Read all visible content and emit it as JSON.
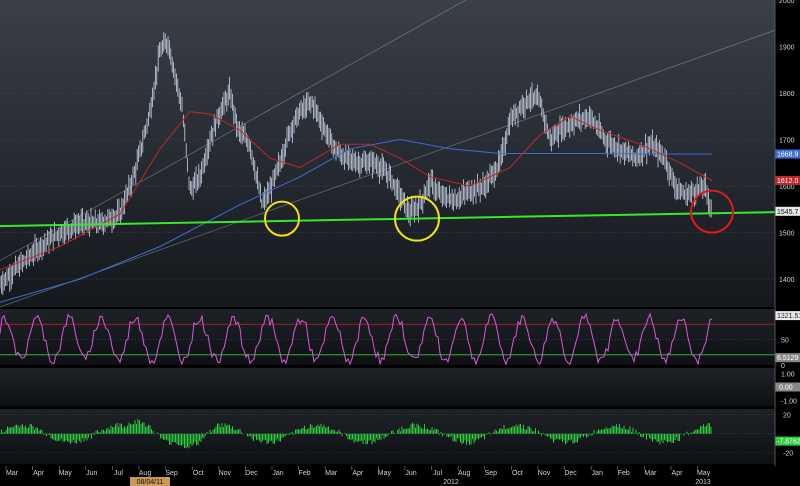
{
  "chart_data": [
    {
      "type": "line",
      "panel": "price",
      "chart_type": "ohlc",
      "ylim": [
        1340,
        2000
      ],
      "y_ticks": [
        "2000",
        "1900",
        "1800",
        "1700",
        "1600",
        "1500",
        "1400"
      ],
      "value_tags": [
        {
          "label": "1668.9",
          "value": 1668.9,
          "color": "#3a6fd0"
        },
        {
          "label": "1612.0",
          "value": 1612.0,
          "color": "#c0282a"
        },
        {
          "label": "1545.7",
          "value": 1545.7,
          "color": "#e8e8e8"
        },
        {
          "label": "1321.51",
          "value": 1321.51,
          "color": "#e8e8e8"
        }
      ],
      "price_series": {
        "x": [
          0,
          20,
          40,
          60,
          80,
          100,
          120,
          135,
          150,
          160,
          168,
          175,
          182,
          190,
          200,
          210,
          220,
          230,
          238,
          250,
          262,
          270,
          280,
          290,
          300,
          312,
          325,
          335,
          345,
          360,
          375,
          390,
          400,
          410,
          420,
          430,
          440,
          455,
          470,
          485,
          500,
          510,
          520,
          530,
          540,
          550,
          560,
          575,
          590,
          605,
          620,
          635,
          650,
          665,
          675,
          685,
          695,
          705,
          712
        ],
        "values": [
          1390,
          1430,
          1470,
          1500,
          1520,
          1520,
          1540,
          1630,
          1760,
          1890,
          1910,
          1840,
          1770,
          1590,
          1620,
          1700,
          1760,
          1800,
          1720,
          1690,
          1560,
          1590,
          1650,
          1720,
          1760,
          1780,
          1720,
          1680,
          1660,
          1650,
          1650,
          1620,
          1580,
          1540,
          1560,
          1610,
          1580,
          1570,
          1590,
          1600,
          1650,
          1740,
          1770,
          1790,
          1780,
          1700,
          1720,
          1740,
          1750,
          1700,
          1680,
          1660,
          1690,
          1660,
          1600,
          1580,
          1590,
          1600,
          1545
        ]
      },
      "ma_red": {
        "x": [
          0,
          60,
          120,
          160,
          190,
          210,
          240,
          270,
          300,
          340,
          370,
          400,
          430,
          470,
          510,
          540,
          570,
          600,
          640,
          680,
          712
        ],
        "values": [
          1420,
          1470,
          1540,
          1680,
          1760,
          1755,
          1720,
          1660,
          1640,
          1690,
          1690,
          1660,
          1620,
          1600,
          1640,
          1710,
          1750,
          1720,
          1690,
          1650,
          1612
        ]
      },
      "ma_blue": {
        "x": [
          0,
          80,
          160,
          240,
          300,
          350,
          400,
          450,
          500,
          550,
          600,
          650,
          712
        ],
        "values": [
          1350,
          1400,
          1470,
          1560,
          1620,
          1680,
          1700,
          1680,
          1670,
          1670,
          1670,
          1669,
          1669
        ]
      },
      "trendline_green": {
        "x": [
          0,
          775
        ],
        "values": [
          1514,
          1544
        ]
      },
      "channel_lines": [
        {
          "x": [
            0,
            470
          ],
          "values": [
            1440,
            2005
          ]
        },
        {
          "x": [
            0,
            775
          ],
          "values": [
            1340,
            1935
          ]
        }
      ],
      "annotations": [
        {
          "shape": "circle",
          "color": "yellow",
          "x": 282,
          "y_value": 1530
        },
        {
          "shape": "circle",
          "color": "yellow",
          "x": 417,
          "y_value": 1530
        },
        {
          "shape": "circle",
          "color": "red",
          "x": 712,
          "y_value": 1545
        }
      ]
    },
    {
      "type": "line",
      "panel": "oscillator",
      "ylim": [
        0,
        110
      ],
      "y_ticks": [
        "100",
        "50",
        "0"
      ],
      "reference_lines": [
        {
          "value": 80,
          "color": "#c0282a"
        },
        {
          "value": 20,
          "color": "#2ecc40"
        }
      ],
      "value_tags": [
        {
          "label": "6.5129",
          "value": 6.5,
          "color": "#888888"
        }
      ],
      "series_color": "#d65bd6"
    },
    {
      "type": "line",
      "panel": "indicator-2",
      "ylim": [
        -1.4,
        1.4
      ],
      "y_ticks": [
        "1.00",
        "-1.00"
      ],
      "value_tags": [
        {
          "label": "0.00",
          "value": 0.0,
          "color": "#888888"
        }
      ]
    },
    {
      "type": "bar",
      "panel": "momentum-histogram",
      "ylim": [
        -32,
        26
      ],
      "y_ticks": [
        "20",
        "-20"
      ],
      "series_color": "#2ecc40",
      "value_tags": [
        {
          "label": "-7.8762",
          "value": -7.88,
          "color": "#2ecc40"
        }
      ]
    }
  ],
  "x_axis": {
    "months": [
      "Mar",
      "Apr",
      "May",
      "Jun",
      "Jul",
      "Aug",
      "Sep",
      "Oct",
      "Nov",
      "Dec",
      "Jan",
      "Feb",
      "Mar",
      "Apr",
      "May",
      "Jun",
      "Jul",
      "Aug",
      "Sep",
      "Oct",
      "Nov",
      "Dec",
      "Jan",
      "Feb",
      "Mar",
      "Apr",
      "May"
    ],
    "years": [
      {
        "label": "08/04/11",
        "x": 150
      },
      {
        "label": "2012",
        "x": 451
      },
      {
        "label": "2013",
        "x": 703
      }
    ]
  }
}
